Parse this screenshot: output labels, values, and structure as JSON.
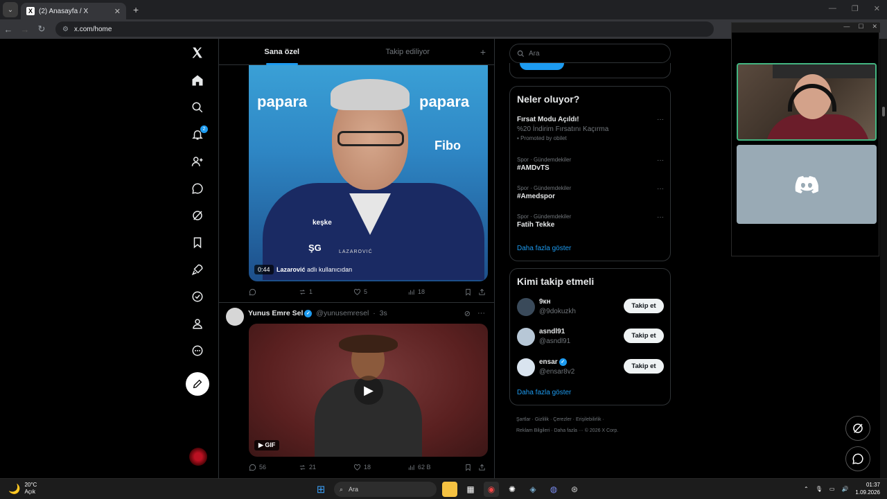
{
  "browser": {
    "tab_title": "(2) Anasayfa / X",
    "tab_favicon": "X",
    "url": "x.com/home"
  },
  "nav": {
    "notifications_badge": "2"
  },
  "feed": {
    "tabs": [
      "Sana özel",
      "Takip ediliyor"
    ],
    "post1": {
      "duration": "0:44",
      "credit_name": "Lazarović",
      "credit_suffix": "adlı kullanıcıdan",
      "image_text": [
        "papara",
        "papara",
        "keşke",
        "ŞG",
        "LAZAROVIĆ",
        "Fibo"
      ],
      "replies": "",
      "retweets": "1",
      "likes": "5",
      "views": "18"
    },
    "post2": {
      "name": "Yunus Emre Sel",
      "handle": "@yunusemresel",
      "time": "3s",
      "gif_label": "GIF",
      "replies": "56",
      "retweets": "21",
      "likes": "18",
      "views": "62 B"
    }
  },
  "search": {
    "placeholder": "Ara"
  },
  "trends": {
    "title": "Neler oluyor?",
    "promo": {
      "title": "Fırsat Modu Açıldı!",
      "desc": "%20 İndirim Fırsatını Kaçırma",
      "promoted": "Promoted by obilet"
    },
    "items": [
      {
        "meta": "Spor · Gündemdekiler",
        "title": "#AMDvTS"
      },
      {
        "meta": "Spor · Gündemdekiler",
        "title": "#Amedspor"
      },
      {
        "meta": "Spor · Gündemdekiler",
        "title": "Fatih Tekke"
      }
    ],
    "show_more": "Daha fazla göster"
  },
  "who_to_follow": {
    "title": "Kimi takip etmeli",
    "follow_label": "Takip et",
    "users": [
      {
        "name": "9кн",
        "handle": "@9dokuzkh",
        "verified": false
      },
      {
        "name": "asndl91",
        "handle": "@asndl91",
        "verified": false
      },
      {
        "name": "ensar",
        "handle": "@ensar8v2",
        "verified": true
      }
    ],
    "show_more": "Daha fazla göster"
  },
  "footer": {
    "line1": "Şartlar · Gizlilik · Çerezler · Erişilebilirlik ·",
    "line2": "Reklam Bilgileri · Daha fazla ··· © 2026 X Corp."
  },
  "taskbar": {
    "temp": "20°C",
    "weather_desc": "Açık",
    "search_label": "Ara",
    "time": "01:37",
    "date": "1.09.2026"
  },
  "colors": {
    "accent": "#1d9bf0",
    "background": "#000000",
    "border": "#2f3336",
    "discord_tile": "#99aab5",
    "cam_border": "#43b581"
  }
}
